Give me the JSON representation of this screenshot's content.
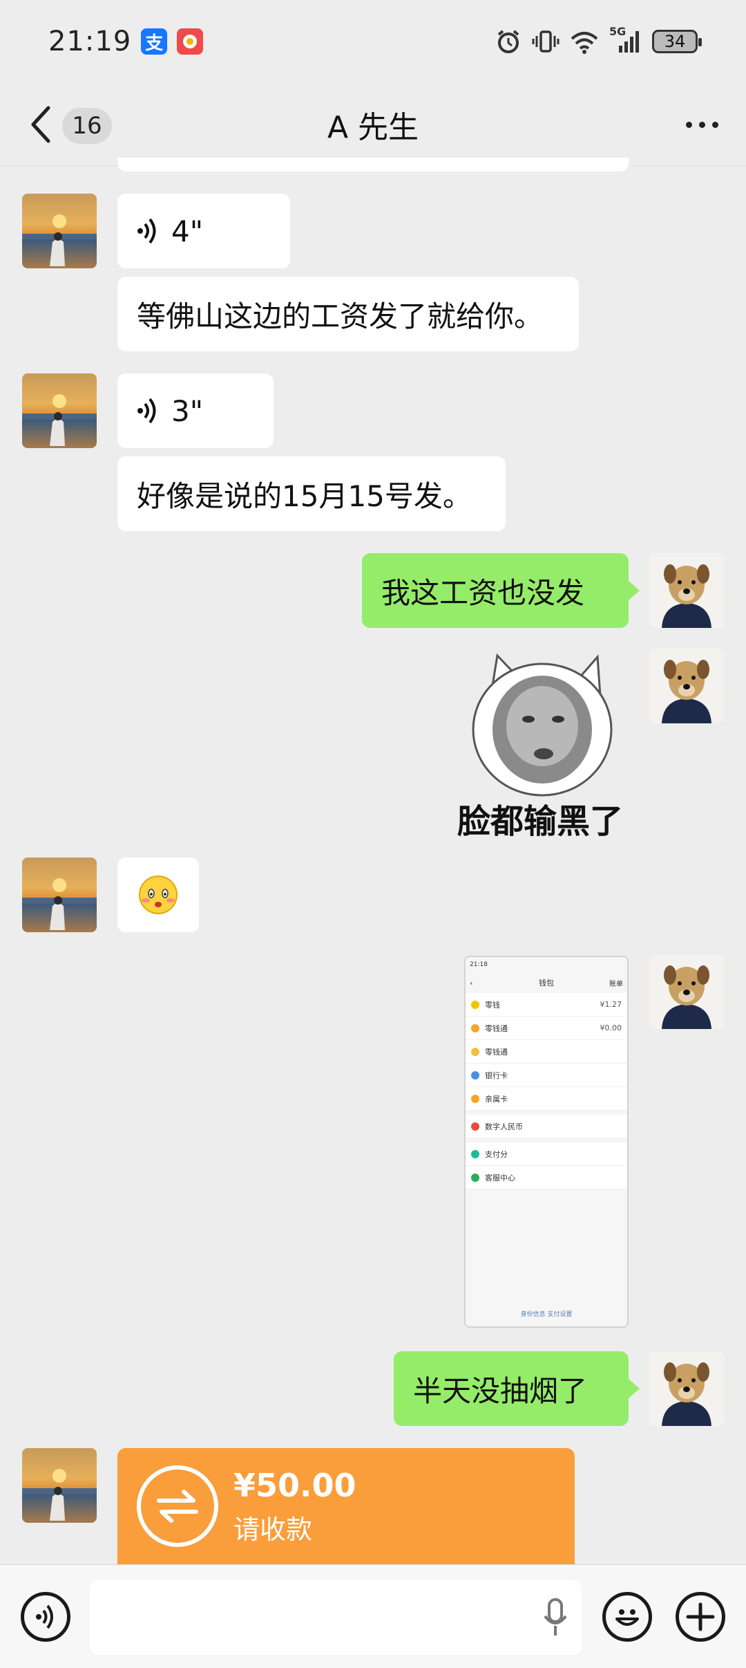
{
  "status_bar": {
    "time": "21:19",
    "alipay_glyph": "支",
    "network": "5G",
    "battery": "34"
  },
  "header": {
    "unread_count": "16",
    "title": "A 先生"
  },
  "messages": [
    {
      "side": "left",
      "type": "voice",
      "duration": "4\""
    },
    {
      "side": "left",
      "type": "text",
      "text": "等佛山这边的工资发了就给你。"
    },
    {
      "side": "left",
      "type": "voice",
      "duration": "3\""
    },
    {
      "side": "left",
      "type": "text",
      "text": "好像是说的15月15号发。"
    },
    {
      "side": "right",
      "type": "text",
      "text": "我这工资也没发"
    },
    {
      "side": "right",
      "type": "sticker",
      "caption": "脸都输黑了"
    },
    {
      "side": "left",
      "type": "emoji",
      "emoji_name": "shy-face-emoji"
    },
    {
      "side": "right",
      "type": "image",
      "image_name": "wallet-screenshot"
    },
    {
      "side": "right",
      "type": "text",
      "text": "半天没抽烟了"
    },
    {
      "side": "left",
      "type": "transfer",
      "amount": "¥50.00",
      "label": "请收款"
    }
  ],
  "screenshot_thumb": {
    "time": "21:18",
    "title": "钱包",
    "right_link": "账单",
    "rows": [
      {
        "label": "零钱",
        "value": "¥1.27"
      },
      {
        "label": "零钱通",
        "value": "¥0.00"
      },
      {
        "label": "零钱通",
        "value": ""
      },
      {
        "label": "银行卡",
        "value": ""
      },
      {
        "label": "亲属卡",
        "value": ""
      },
      {
        "label": "数字人民币",
        "value": ""
      },
      {
        "label": "支付分",
        "value": ""
      },
      {
        "label": "客服中心",
        "value": ""
      }
    ],
    "footer": "身份信息   支付设置"
  },
  "colors": {
    "background": "#ededed",
    "bubble_green": "#95ec69",
    "bubble_white": "#ffffff",
    "transfer_orange": "#fa9d3b"
  },
  "icons": [
    "back-icon",
    "more-icon",
    "voice-wave-icon",
    "transfer-arrows-icon",
    "voice-input-icon",
    "microphone-icon",
    "emoji-icon",
    "plus-icon",
    "wifi-icon",
    "signal-icon",
    "vibrate-icon",
    "alarm-icon"
  ]
}
